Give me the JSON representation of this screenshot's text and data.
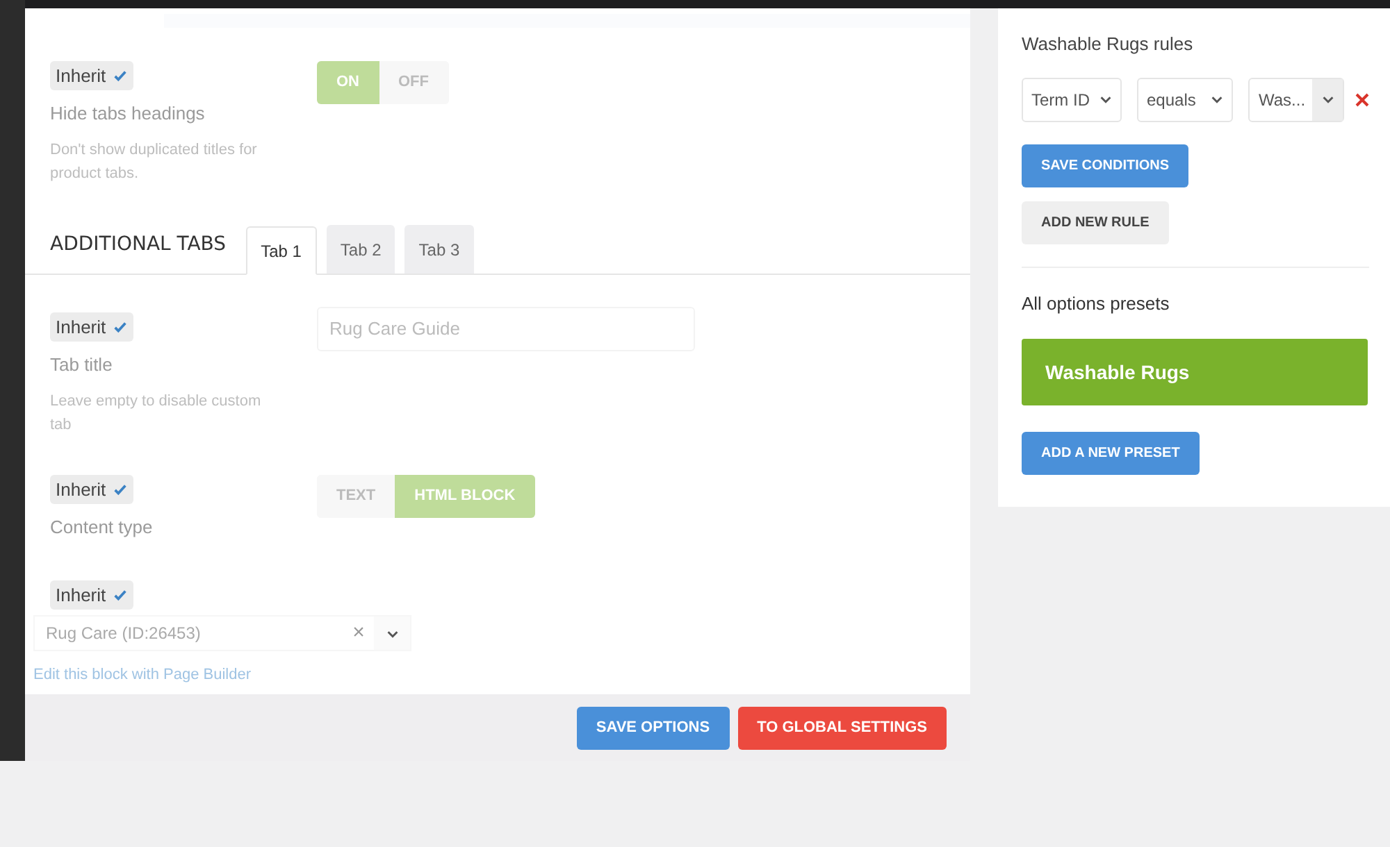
{
  "settings": [
    {
      "kind": "toggle",
      "inherit": {
        "label": "Inherit",
        "checked": true
      },
      "label": "Hide tabs headings",
      "description": "Don't show duplicated titles for product tabs.",
      "options": [
        {
          "label": "ON",
          "selected": true
        },
        {
          "label": "OFF",
          "selected": false
        }
      ]
    }
  ],
  "additional_tabs": {
    "heading": "ADDITIONAL TABS",
    "tabs": [
      {
        "label": "Tab 1",
        "selected": true
      },
      {
        "label": "Tab 2",
        "selected": false
      },
      {
        "label": "Tab 3",
        "selected": false
      }
    ]
  },
  "tab_settings": [
    {
      "kind": "text",
      "inherit": {
        "label": "Inherit",
        "checked": true
      },
      "label": "Tab title",
      "description": "Leave empty to disable custom tab",
      "placeholder": "Rug Care Guide"
    },
    {
      "kind": "toggle",
      "inherit": {
        "label": "Inherit",
        "checked": true
      },
      "label": "Content type",
      "options": [
        {
          "label": "TEXT",
          "selected": false
        },
        {
          "label": "HTML BLOCK",
          "selected": true
        }
      ]
    },
    {
      "kind": "select",
      "inherit": {
        "label": "Inherit",
        "checked": true
      },
      "value": "Rug Care (ID:26453)",
      "clear": "×",
      "link": "Edit this block with Page Builder"
    }
  ],
  "footer_buttons": [
    {
      "label": "SAVE OPTIONS",
      "kind": "primary"
    },
    {
      "label": "TO GLOBAL SETTINGS",
      "kind": "danger"
    }
  ],
  "rules": {
    "title": "Washable Rugs rules",
    "conditions": [
      {
        "field": "Term ID",
        "operator": "equals",
        "value": "Was..."
      }
    ],
    "save_button": "SAVE CONDITIONS",
    "add_button": "ADD NEW RULE"
  },
  "presets": {
    "title": "All options presets",
    "items": [
      {
        "label": "Washable Rugs",
        "selected": true
      }
    ],
    "add_button": "ADD A NEW PRESET"
  }
}
